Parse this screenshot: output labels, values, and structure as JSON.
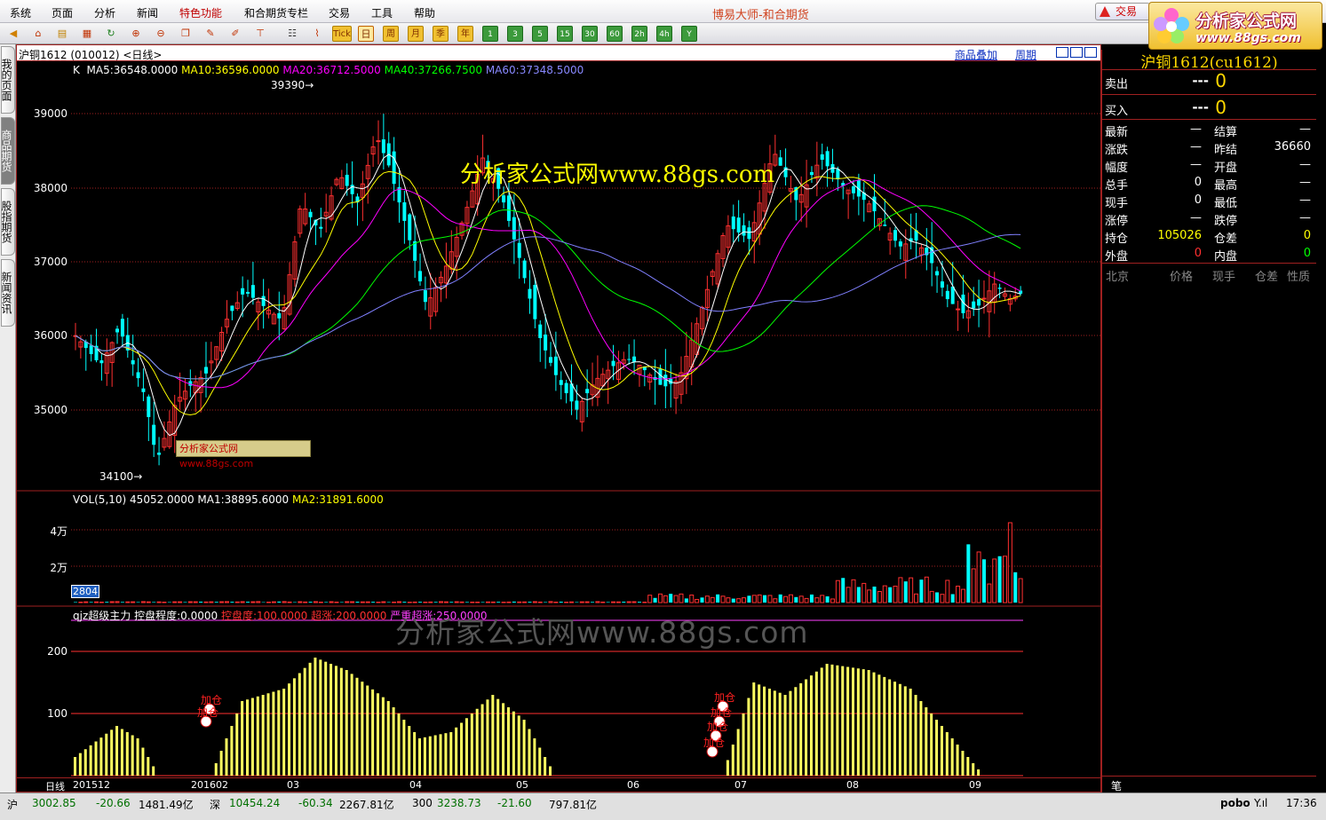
{
  "menu": [
    "系统",
    "页面",
    "分析",
    "新闻",
    "特色功能",
    "和合期货专栏",
    "交易",
    "工具",
    "帮助"
  ],
  "app_title": "博易大师-和合期货",
  "trade_label": "交易",
  "logo": {
    "line1": "分析家公式网",
    "line2": "www.88gs.com"
  },
  "toolbar_periods": [
    "日",
    "周",
    "月",
    "季",
    "年",
    "1",
    "3",
    "5",
    "15",
    "30",
    "60",
    "2h",
    "4h",
    "Y"
  ],
  "toolbar_special": "Tick",
  "left_tabs": [
    "我的页面",
    "商品期货",
    "股指期货",
    "新闻资讯"
  ],
  "chart_header": {
    "symbol": "沪铜1612 (010012) <日线>",
    "overlay": "商品叠加",
    "period": "周期"
  },
  "price_panel": {
    "k_label": "K",
    "ma": [
      {
        "label": "MA5:36548.0000",
        "color": "#ffffff"
      },
      {
        "label": "MA10:36596.0000",
        "color": "#ffff00"
      },
      {
        "label": "MA20:36712.5000",
        "color": "#ff00ff"
      },
      {
        "label": "MA40:37266.7500",
        "color": "#00ff00"
      },
      {
        "label": "MA60:37348.5000",
        "color": "#8080ff"
      }
    ],
    "ticks": [
      "39000",
      "38000",
      "37000",
      "36000",
      "35000"
    ],
    "high_label": "39390",
    "low_label": "34100"
  },
  "volume_panel": {
    "title": "VOL(5,10)",
    "value": "45052.0000",
    "ma1": "MA1:38895.6000",
    "ma2": "MA2:31891.6000",
    "ticks": [
      "4万",
      "2万"
    ],
    "badge": "2804"
  },
  "indicator_panel": {
    "title": "qjz超级主力",
    "a": "控盘程度:0.0000",
    "b": "控盘度:100.0000",
    "c": "超涨:200.0000",
    "d": "严重超涨:250.0000",
    "ticks": [
      "200",
      "100"
    ],
    "signal_text": "加仓"
  },
  "watermark": {
    "main": "分析家公式网www.88gs.com",
    "indicator": "分析家公式网www.88gs.com",
    "box": "分析家公式网www.88gs.com"
  },
  "dates": {
    "period_label": "日线",
    "labels": [
      "201512",
      "201602",
      "03",
      "04",
      "05",
      "06",
      "07",
      "08",
      "09"
    ]
  },
  "quote": {
    "title": "沪铜1612(cu1612)",
    "sell_label": "卖出",
    "sell_price": "---",
    "sell_qty": "0",
    "buy_label": "买入",
    "buy_price": "---",
    "buy_qty": "0",
    "rows": [
      {
        "l1": "最新",
        "v1": "—",
        "c1": "#ffffff",
        "l2": "结算",
        "v2": "—",
        "c2": "#ffffff"
      },
      {
        "l1": "涨跌",
        "v1": "—",
        "c1": "#ffffff",
        "l2": "昨结",
        "v2": "36660",
        "c2": "#ffffff"
      },
      {
        "l1": "幅度",
        "v1": "—",
        "c1": "#ffffff",
        "l2": "开盘",
        "v2": "—",
        "c2": "#ffffff"
      },
      {
        "l1": "总手",
        "v1": "0",
        "c1": "#ffffff",
        "l2": "最高",
        "v2": "—",
        "c2": "#ffffff"
      },
      {
        "l1": "现手",
        "v1": "0",
        "c1": "#ffffff",
        "l2": "最低",
        "v2": "—",
        "c2": "#ffffff"
      },
      {
        "l1": "涨停",
        "v1": "—",
        "c1": "#ffffff",
        "l2": "跌停",
        "v2": "—",
        "c2": "#ffffff"
      },
      {
        "l1": "持仓",
        "v1": "105026",
        "c1": "#ffff00",
        "l2": "仓差",
        "v2": "0",
        "c2": "#ffff00"
      },
      {
        "l1": "外盘",
        "v1": "0",
        "c1": "#ff3030",
        "l2": "内盘",
        "v2": "0",
        "c2": "#00ff00"
      }
    ],
    "tick_headers": [
      "北京",
      "价格",
      "现手",
      "仓差",
      "性质"
    ],
    "footer_tab": "笔"
  },
  "status": {
    "sh_label": "沪",
    "sh_index": "3002.85",
    "sh_change": "-20.66",
    "sh_amount": "1481.49亿",
    "sz_label": "深",
    "sz_index": "10454.24",
    "sz_change": "-60.34",
    "sz_amount": "2267.81亿",
    "c300_label": "300",
    "c300_index": "3238.73",
    "c300_change": "-21.60",
    "c300_amount": "797.81亿",
    "brand": "pobo",
    "time": "17:36"
  },
  "colors": {
    "up": "#ff3030",
    "down": "#00ffff",
    "grid": "#a02020",
    "indicator": "#ffff60"
  }
}
